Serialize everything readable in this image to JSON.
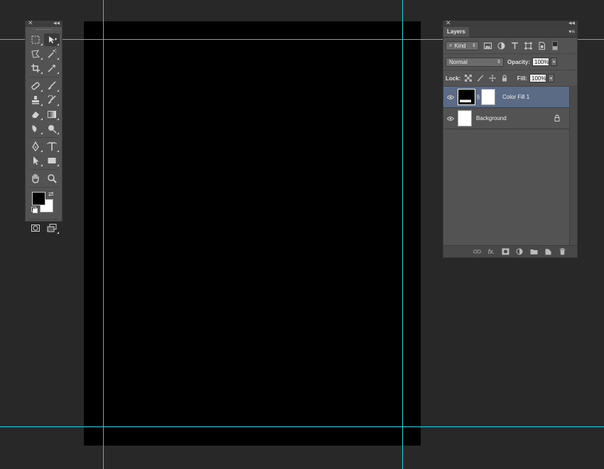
{
  "layers_panel": {
    "tab_label": "Layers",
    "filter_kind": "Kind",
    "blend_mode": "Normal",
    "opacity_label": "Opacity:",
    "opacity_value": "100%",
    "lock_label": "Lock:",
    "fill_label": "Fill:",
    "fill_value": "100%",
    "layers": [
      {
        "name": "Color Fill 1",
        "selected": true
      },
      {
        "name": "Background",
        "selected": false
      }
    ]
  },
  "tools_panel": {
    "foreground_color": "#000000",
    "background_color": "#ffffff"
  },
  "colors": {
    "guide": "#1ec8dc",
    "selected_layer": "#5c6b85",
    "document": "#000000"
  }
}
